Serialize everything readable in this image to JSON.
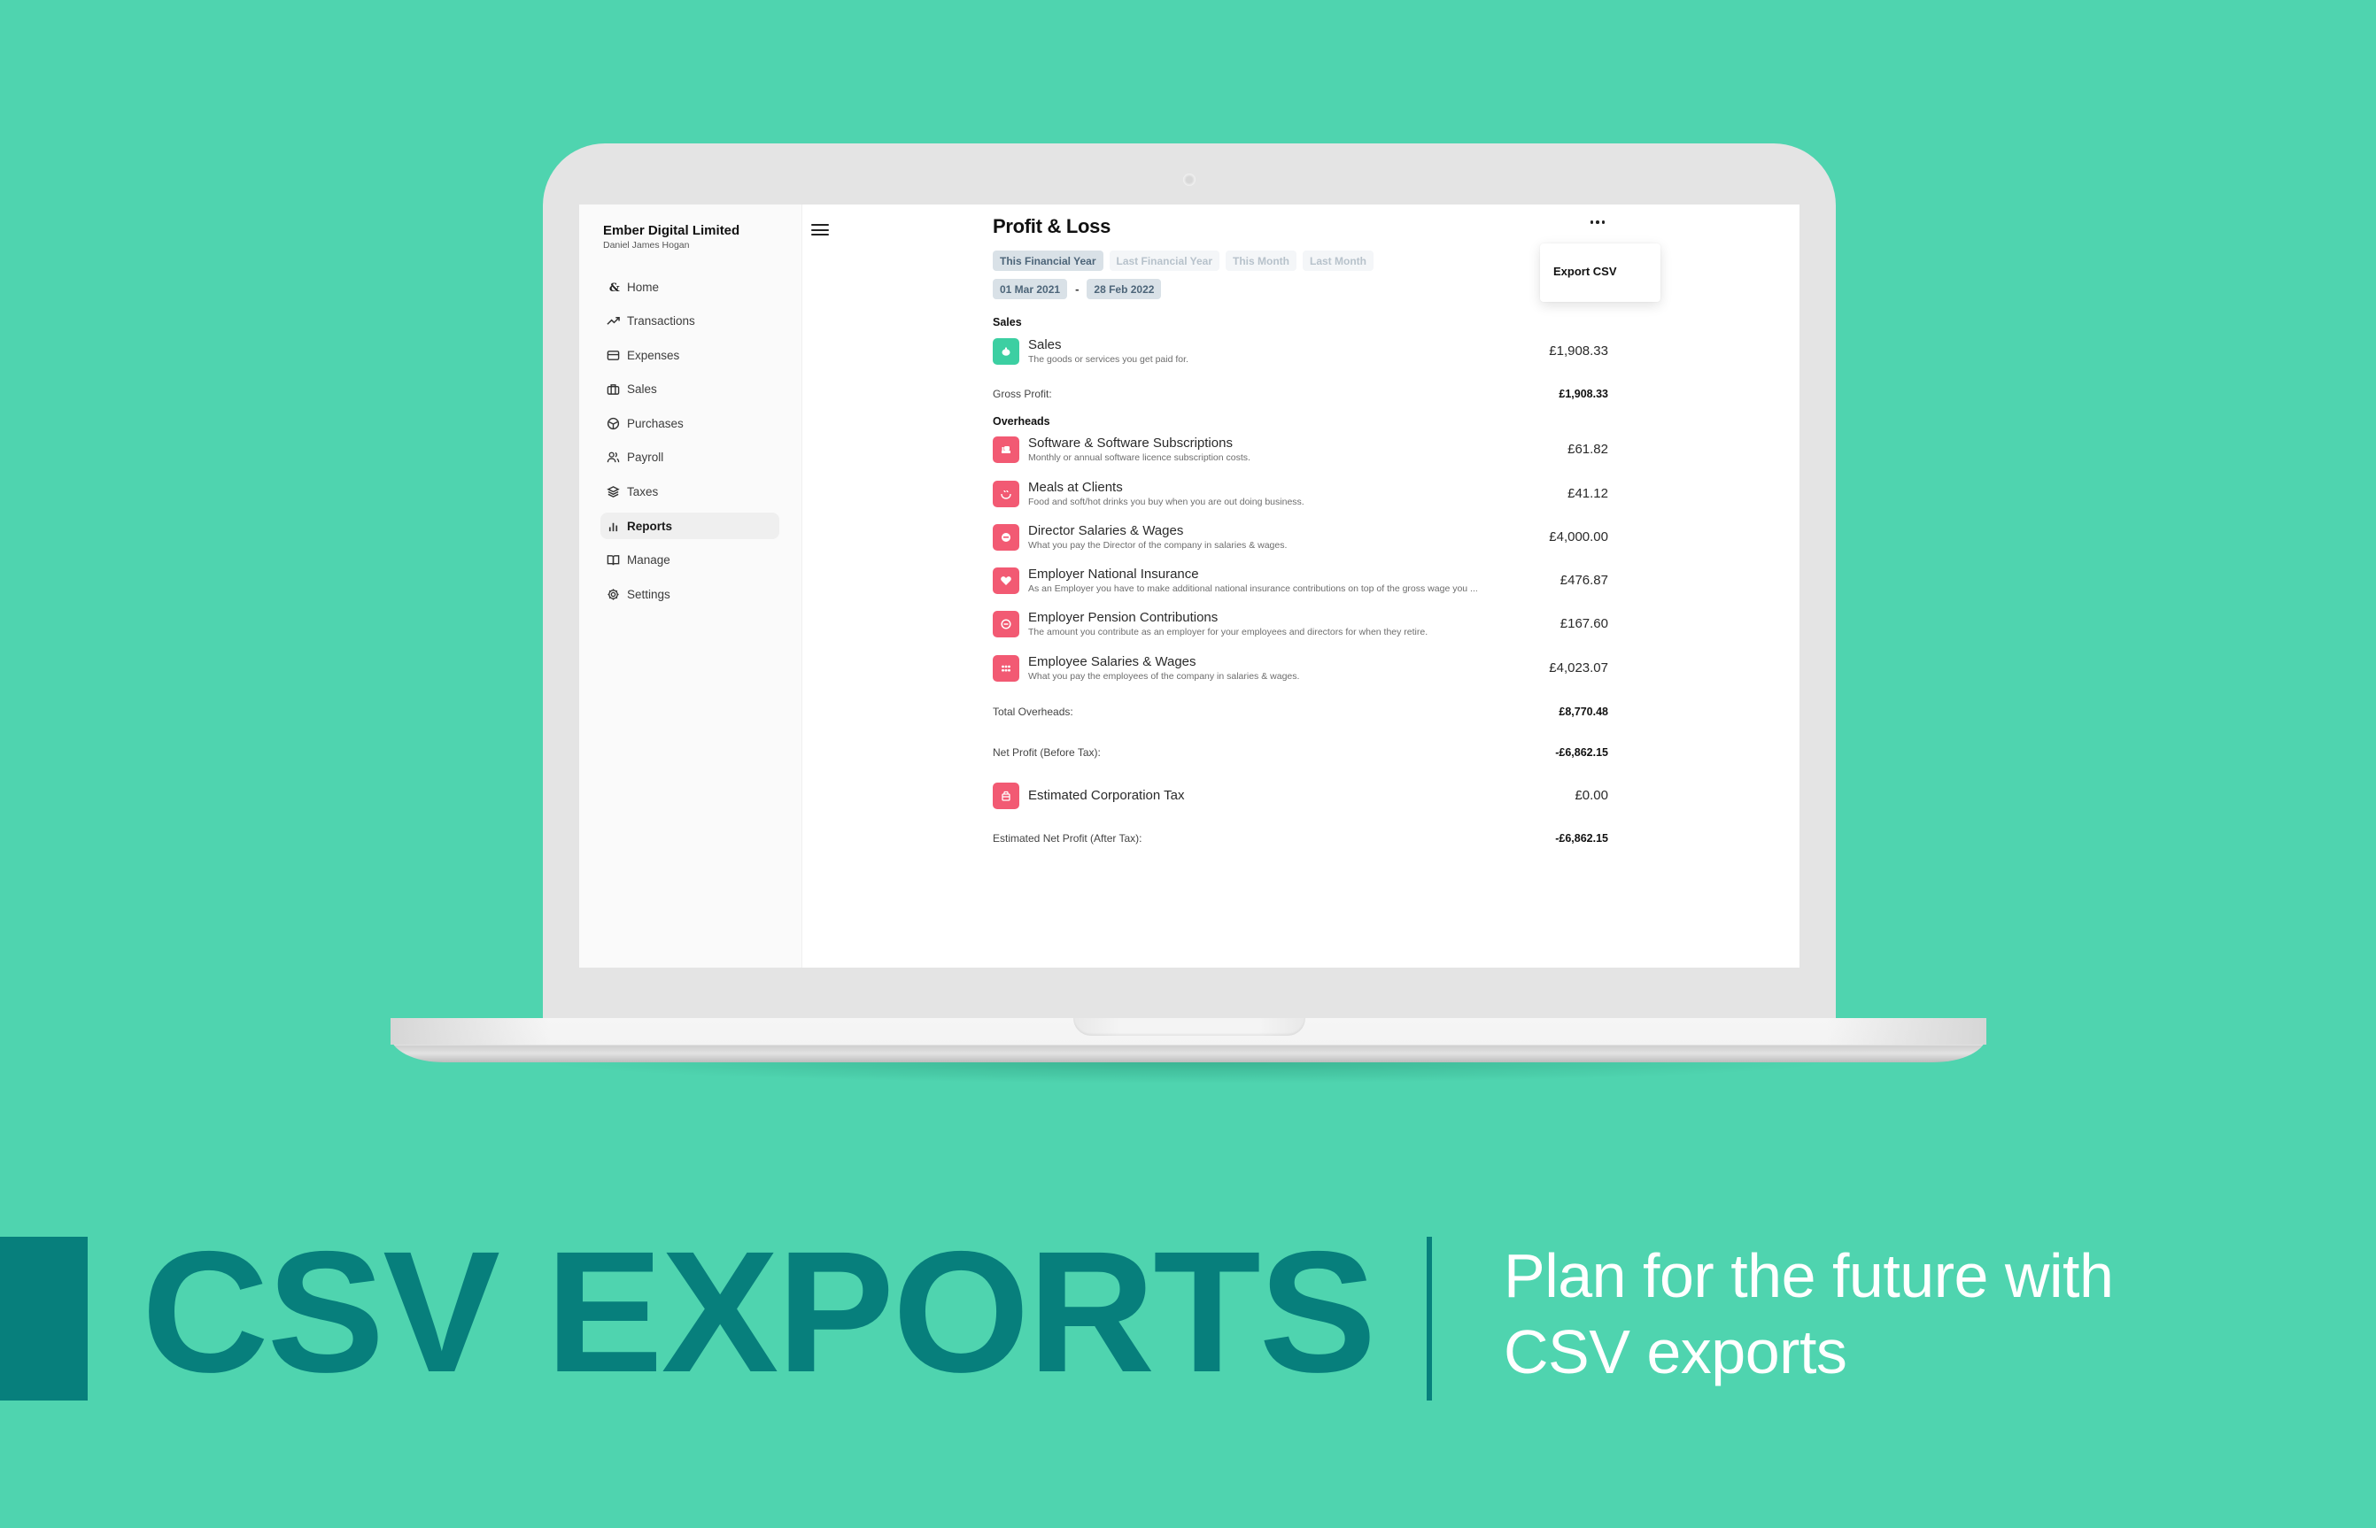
{
  "colors": {
    "background": "#4fd4af",
    "brand_dark": "#077f7c",
    "income_icon": "#3ccfa2",
    "expense_icon": "#f25a73",
    "tab_active_bg": "#d9e1e7",
    "tab_active_text": "#4d6579"
  },
  "sidebar": {
    "org_name": "Ember Digital Limited",
    "user_name": "Daniel James Hogan",
    "items": [
      {
        "label": "Home",
        "icon": "home-icon"
      },
      {
        "label": "Transactions",
        "icon": "trending-up-icon"
      },
      {
        "label": "Expenses",
        "icon": "credit-card-icon"
      },
      {
        "label": "Sales",
        "icon": "briefcase-icon"
      },
      {
        "label": "Purchases",
        "icon": "package-icon"
      },
      {
        "label": "Payroll",
        "icon": "users-icon"
      },
      {
        "label": "Taxes",
        "icon": "layers-icon"
      },
      {
        "label": "Reports",
        "icon": "bar-chart-icon",
        "active": true
      },
      {
        "label": "Manage",
        "icon": "book-open-icon"
      },
      {
        "label": "Settings",
        "icon": "gear-icon"
      }
    ]
  },
  "header": {
    "title": "Profit & Loss",
    "more_menu": {
      "icon": "more-horizontal-icon",
      "items": [
        "Export CSV"
      ]
    }
  },
  "period_tabs": [
    {
      "label": "This Financial Year",
      "active": true
    },
    {
      "label": "Last Financial Year",
      "active": false
    },
    {
      "label": "This Month",
      "active": false
    },
    {
      "label": "Last Month",
      "active": false
    }
  ],
  "date_range": {
    "start": "01 Mar 2021",
    "separator": "-",
    "end": "28 Feb 2022"
  },
  "report": {
    "sales_heading": "Sales",
    "sales": [
      {
        "title": "Sales",
        "description": "The goods or services you get paid for.",
        "amount": "£1,908.33",
        "icon": "piggy-bank-icon"
      }
    ],
    "gross_profit": {
      "label": "Gross Profit:",
      "value": "£1,908.33"
    },
    "overheads_heading": "Overheads",
    "overheads": [
      {
        "title": "Software & Software Subscriptions",
        "description": "Monthly or annual software licence subscription costs.",
        "amount": "£61.82",
        "icon": "laptop-icon"
      },
      {
        "title": "Meals at Clients",
        "description": "Food and soft/hot drinks you buy when you are out doing business.",
        "amount": "£41.12",
        "icon": "meal-icon"
      },
      {
        "title": "Director Salaries & Wages",
        "description": "What you pay the Director of the company in salaries & wages.",
        "amount": "£4,000.00",
        "icon": "director-icon"
      },
      {
        "title": "Employer National Insurance",
        "description": "As an Employer you have to make additional national insurance contributions on top of the gross wage you ...",
        "amount": "£476.87",
        "icon": "heart-icon"
      },
      {
        "title": "Employer Pension Contributions",
        "description": "The amount you contribute as an employer for your employees and directors for when they retire.",
        "amount": "£167.60",
        "icon": "pension-icon"
      },
      {
        "title": "Employee Salaries & Wages",
        "description": "What you pay the employees of the company in salaries & wages.",
        "amount": "£4,023.07",
        "icon": "team-icon"
      }
    ],
    "total_overheads": {
      "label": "Total Overheads:",
      "value": "£8,770.48"
    },
    "net_profit_before_tax": {
      "label": "Net Profit (Before Tax):",
      "value": "-£6,862.15"
    },
    "corporation_tax": {
      "title": "Estimated Corporation Tax",
      "amount": "£0.00",
      "icon": "tax-icon"
    },
    "net_profit_after_tax": {
      "label": "Estimated Net Profit (After Tax):",
      "value": "-£6,862.15"
    }
  },
  "banner": {
    "headline": "CSV EXPORTS",
    "subtitle_line1": "Plan for the future with",
    "subtitle_line2": "CSV exports"
  }
}
